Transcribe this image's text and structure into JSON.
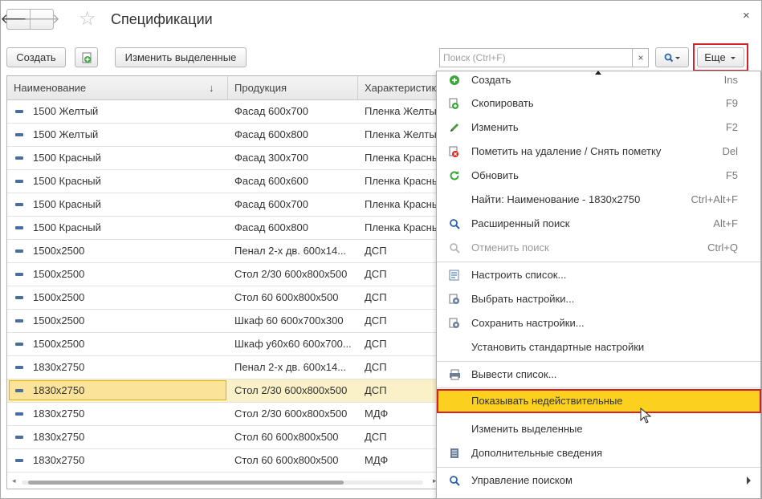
{
  "window": {
    "title": "Спецификации",
    "close_glyph": "×"
  },
  "toolbar": {
    "create_label": "Создать",
    "change_selected_label": "Изменить выделенные",
    "search_placeholder": "Поиск (Ctrl+F)",
    "search_clear": "×",
    "more_label": "Еще"
  },
  "table": {
    "columns": [
      "Наименование",
      "Продукция",
      "Характеристика"
    ],
    "sort_glyph": "↓",
    "rows": [
      {
        "name": "1500 Желтый",
        "product": "Фасад 600х700",
        "char": "Пленка Желтый"
      },
      {
        "name": "1500 Желтый",
        "product": "Фасад 600х800",
        "char": "Пленка Желтый"
      },
      {
        "name": "1500 Красный",
        "product": "Фасад 300х700",
        "char": "Пленка Красный"
      },
      {
        "name": "1500 Красный",
        "product": "Фасад 600х600",
        "char": "Пленка Красный"
      },
      {
        "name": "1500 Красный",
        "product": "Фасад 600х700",
        "char": "Пленка Красный"
      },
      {
        "name": "1500 Красный",
        "product": "Фасад 600х800",
        "char": "Пленка Красный"
      },
      {
        "name": "1500x2500",
        "product": "Пенал 2-х дв. 600х14...",
        "char": "ДСП"
      },
      {
        "name": "1500x2500",
        "product": "Стол 2/30 600х800х500",
        "char": "ДСП"
      },
      {
        "name": "1500x2500",
        "product": "Стол 60 600х800х500",
        "char": "ДСП"
      },
      {
        "name": "1500x2500",
        "product": "Шкаф 60 600х700х300",
        "char": "ДСП"
      },
      {
        "name": "1500x2500",
        "product": "Шкаф у60х60 600х700...",
        "char": "ДСП"
      },
      {
        "name": "1830x2750",
        "product": "Пенал 2-х дв. 600х14...",
        "char": "ДСП"
      },
      {
        "name": "1830x2750",
        "product": "Стол 2/30 600х800х500",
        "char": "ДСП"
      },
      {
        "name": "1830x2750",
        "product": "Стол 2/30 600х800х500",
        "char": "МДФ"
      },
      {
        "name": "1830x2750",
        "product": "Стол 60 600х800х500",
        "char": "ДСП"
      },
      {
        "name": "1830x2750",
        "product": "Стол 60 600х800х500",
        "char": "МДФ"
      }
    ]
  },
  "menu": {
    "items": [
      {
        "label": "Создать",
        "shortcut": "Ins",
        "icon": "plus-circle-icon"
      },
      {
        "label": "Скопировать",
        "shortcut": "F9",
        "icon": "copy-icon"
      },
      {
        "label": "Изменить",
        "shortcut": "F2",
        "icon": "pencil-icon"
      },
      {
        "label": "Пометить на удаление / Снять пометку",
        "shortcut": "Del",
        "icon": "delete-mark-icon"
      },
      {
        "label": "Обновить",
        "shortcut": "F5",
        "icon": "refresh-icon"
      },
      {
        "label": "Найти: Наименование - 1830x2750",
        "shortcut": "Ctrl+Alt+F",
        "icon": ""
      },
      {
        "label": "Расширенный поиск",
        "shortcut": "Alt+F",
        "icon": "advanced-search-icon"
      },
      {
        "label": "Отменить поиск",
        "shortcut": "Ctrl+Q",
        "icon": "cancel-search-icon"
      },
      {
        "label": "Настроить список...",
        "shortcut": "",
        "icon": "list-settings-icon"
      },
      {
        "label": "Выбрать настройки...",
        "shortcut": "",
        "icon": "load-settings-icon"
      },
      {
        "label": "Сохранить настройки...",
        "shortcut": "",
        "icon": "save-settings-icon"
      },
      {
        "label": "Установить стандартные настройки",
        "shortcut": "",
        "icon": ""
      },
      {
        "label": "Вывести список...",
        "shortcut": "",
        "icon": "print-list-icon"
      },
      {
        "label": "Показывать недействительные",
        "shortcut": "",
        "icon": ""
      },
      {
        "label": "Изменить выделенные",
        "shortcut": "",
        "icon": ""
      },
      {
        "label": "Дополнительные сведения",
        "shortcut": "",
        "icon": "document-icon"
      },
      {
        "label": "Управление поиском",
        "shortcut": "",
        "icon": "search-icon"
      }
    ]
  },
  "colors": {
    "highlight": "#fcd01f",
    "outline_red": "#d4212a",
    "selected_row": "#faf1c8"
  }
}
